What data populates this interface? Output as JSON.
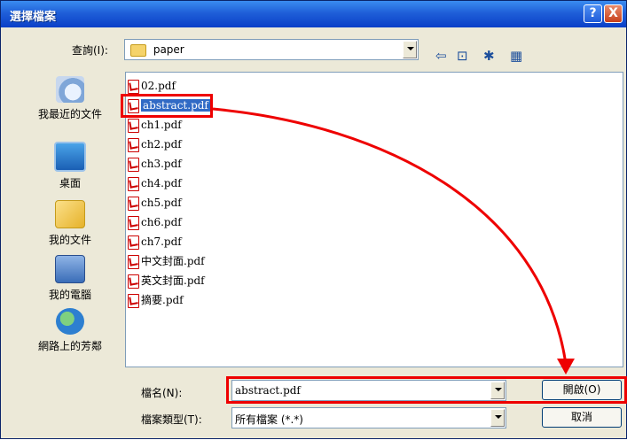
{
  "window": {
    "title": "選擇檔案",
    "help_glyph": "?",
    "close_glyph": "X"
  },
  "lookin": {
    "label": "查詢(I):",
    "folder": "paper"
  },
  "toolbar": {
    "back_glyph": "⇦",
    "up_glyph": "⊡",
    "new_folder_glyph": "✱",
    "view_glyph": "▦"
  },
  "places": [
    {
      "label": "我最近的文件",
      "icon": "recent-documents-icon"
    },
    {
      "label": "桌面",
      "icon": "desktop-icon"
    },
    {
      "label": "我的文件",
      "icon": "my-documents-icon"
    },
    {
      "label": "我的電腦",
      "icon": "my-computer-icon"
    },
    {
      "label": "網路上的芳鄰",
      "icon": "network-places-icon"
    }
  ],
  "files": [
    "02.pdf",
    "abstract.pdf",
    "ch1.pdf",
    "ch2.pdf",
    "ch3.pdf",
    "ch4.pdf",
    "ch5.pdf",
    "ch6.pdf",
    "ch7.pdf",
    "中文封面.pdf",
    "英文封面.pdf",
    "摘要.pdf"
  ],
  "selected_file": "abstract.pdf",
  "filename": {
    "label": "檔名(N):",
    "value": "abstract.pdf"
  },
  "filetype": {
    "label": "檔案類型(T):",
    "value": "所有檔案 (*.*)"
  },
  "buttons": {
    "open": "開啟(O)",
    "cancel": "取消"
  },
  "colors": {
    "highlight_red": "#ee0000",
    "selection_blue": "#316ac5"
  }
}
